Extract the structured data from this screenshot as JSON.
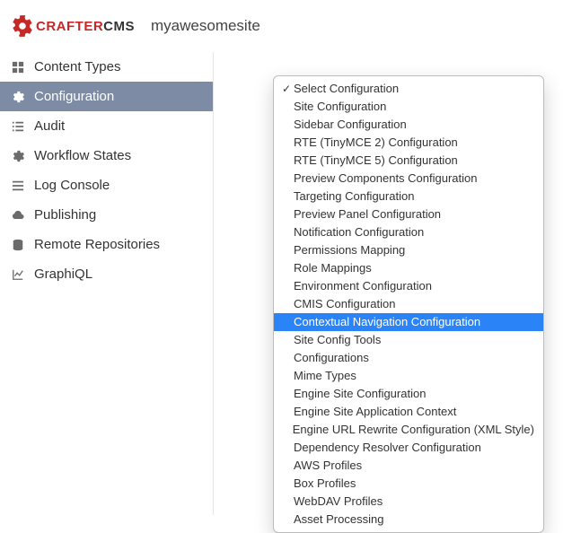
{
  "logo": {
    "brand_red": "CRAFTER",
    "brand_dark": "CMS"
  },
  "site_name": "myawesomesite",
  "sidebar": {
    "items": [
      {
        "label": "Content Types",
        "icon": "grid-icon"
      },
      {
        "label": "Configuration",
        "icon": "gear-icon",
        "active": true
      },
      {
        "label": "Audit",
        "icon": "list-icon"
      },
      {
        "label": "Workflow States",
        "icon": "gear-icon"
      },
      {
        "label": "Log Console",
        "icon": "bars-icon"
      },
      {
        "label": "Publishing",
        "icon": "cloud-icon"
      },
      {
        "label": "Remote Repositories",
        "icon": "db-icon"
      },
      {
        "label": "GraphiQL",
        "icon": "chart-icon"
      }
    ]
  },
  "dropdown": {
    "items": [
      {
        "label": "Select Configuration",
        "checked": true
      },
      {
        "label": "Site Configuration"
      },
      {
        "label": "Sidebar Configuration"
      },
      {
        "label": "RTE (TinyMCE 2) Configuration"
      },
      {
        "label": "RTE (TinyMCE 5) Configuration"
      },
      {
        "label": "Preview Components Configuration"
      },
      {
        "label": "Targeting Configuration"
      },
      {
        "label": "Preview Panel Configuration"
      },
      {
        "label": "Notification Configuration"
      },
      {
        "label": "Permissions Mapping"
      },
      {
        "label": "Role Mappings"
      },
      {
        "label": "Environment Configuration"
      },
      {
        "label": "CMIS Configuration"
      },
      {
        "label": "Contextual Navigation Configuration",
        "highlight": true
      },
      {
        "label": "Site Config Tools"
      },
      {
        "label": "Configurations"
      },
      {
        "label": "Mime Types"
      },
      {
        "label": "Engine Site Configuration"
      },
      {
        "label": "Engine Site Application Context"
      },
      {
        "label": "Engine URL Rewrite Configuration (XML Style)"
      },
      {
        "label": "Dependency Resolver Configuration"
      },
      {
        "label": "AWS Profiles"
      },
      {
        "label": "Box Profiles"
      },
      {
        "label": "WebDAV Profiles"
      },
      {
        "label": "Asset Processing"
      }
    ]
  }
}
